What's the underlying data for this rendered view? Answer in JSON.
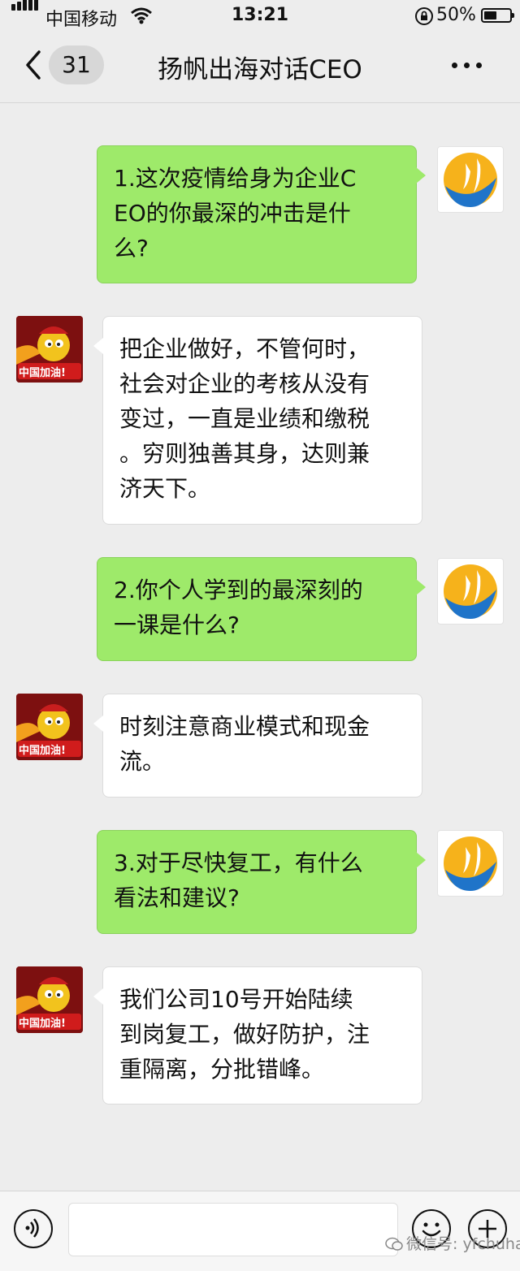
{
  "status_bar": {
    "carrier": "中国移动",
    "time": "13:21",
    "battery": "50%",
    "battery_level": 0.5,
    "icons": [
      "signal-icon",
      "wifi-icon",
      "orientation-lock-icon",
      "battery-icon"
    ]
  },
  "nav": {
    "back_badge": "31",
    "title": "扬帆出海对话CEO",
    "icons": [
      "back-chevron-icon",
      "more-icon"
    ]
  },
  "messages": [
    {
      "sender": "me",
      "text": "1.这次疫情给身为企业C\nEO的你最深的冲击是什\n么?"
    },
    {
      "sender": "other",
      "text": "把企业做好，不管何时，\n社会对企业的考核从没有\n变过，一直是业绩和缴税\n。穷则独善其身，达则兼\n济天下。"
    },
    {
      "sender": "me",
      "text": "2.你个人学到的最深刻的\n一课是什么?"
    },
    {
      "sender": "other",
      "text": "时刻注意商业模式和现金\n流。"
    },
    {
      "sender": "me",
      "text": "3.对于尽快复工，有什么\n看法和建议?"
    },
    {
      "sender": "other",
      "text": "我们公司10号开始陆续\n到岗复工，做好防护，注\n重隔离，分批错峰。"
    }
  ],
  "avatar_other_caption": "中国加油!",
  "input_bar": {
    "watermark": "微信号: yfchuhai",
    "icons": [
      "voice-icon",
      "emoji-icon",
      "plus-icon"
    ]
  },
  "colors": {
    "background": "#ededed",
    "sent_bubble": "#9eea6a",
    "received_bubble": "#ffffff"
  }
}
